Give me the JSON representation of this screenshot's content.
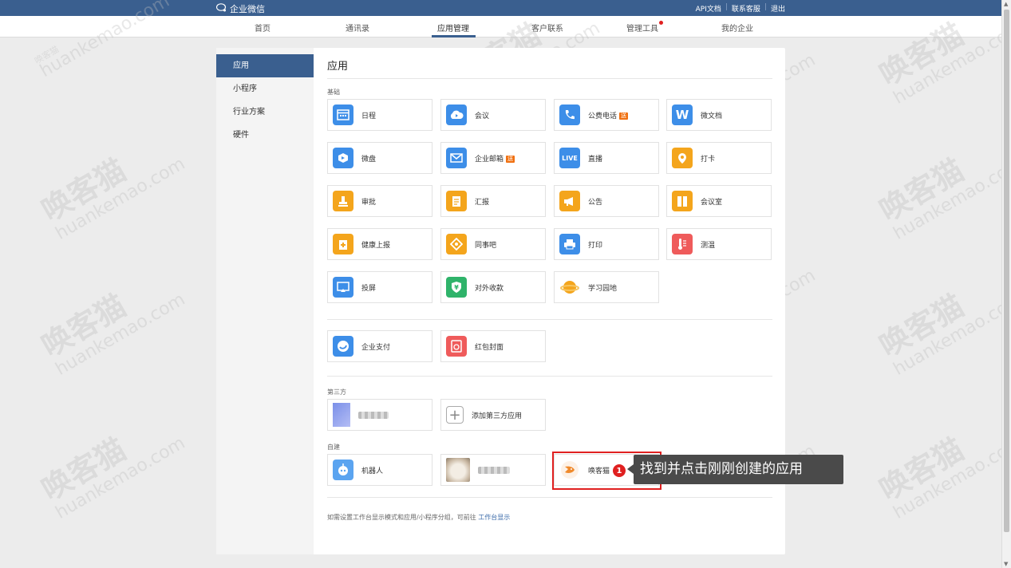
{
  "topbar": {
    "logo": "企业微信",
    "api": "API文档",
    "support": "联系客服",
    "logout": "退出"
  },
  "nav": {
    "tabs": [
      "首页",
      "通讯录",
      "应用管理",
      "客户联系",
      "管理工具",
      "我的企业"
    ]
  },
  "sidebar": {
    "items": [
      "应用",
      "小程序",
      "行业方案",
      "硬件"
    ]
  },
  "main": {
    "title": "应用",
    "basic_label": "基础",
    "basic_apps": [
      {
        "label": "日程",
        "icon": "calendar-icon"
      },
      {
        "label": "会议",
        "icon": "cloud-icon"
      },
      {
        "label": "公费电话",
        "icon": "phone-icon",
        "badge": "送"
      },
      {
        "label": "微文档",
        "icon": "doc-w-icon"
      },
      {
        "label": "微盘",
        "icon": "drive-icon"
      },
      {
        "label": "企业邮箱",
        "icon": "mail-icon",
        "badge": "送"
      },
      {
        "label": "直播",
        "icon": "live-icon"
      },
      {
        "label": "打卡",
        "icon": "location-icon"
      },
      {
        "label": "审批",
        "icon": "stamp-icon"
      },
      {
        "label": "汇报",
        "icon": "report-icon"
      },
      {
        "label": "公告",
        "icon": "megaphone-icon"
      },
      {
        "label": "会议室",
        "icon": "door-icon"
      },
      {
        "label": "健康上报",
        "icon": "health-icon"
      },
      {
        "label": "同事吧",
        "icon": "diamond-icon"
      },
      {
        "label": "打印",
        "icon": "printer-icon"
      },
      {
        "label": "测温",
        "icon": "thermometer-icon"
      },
      {
        "label": "投屏",
        "icon": "screen-icon"
      },
      {
        "label": "对外收款",
        "icon": "shield-yen-icon"
      },
      {
        "label": "学习园地",
        "icon": "planet-icon"
      }
    ],
    "extra_apps": [
      {
        "label": "企业支付",
        "icon": "pay-icon"
      },
      {
        "label": "红包封面",
        "icon": "red-packet-icon"
      }
    ],
    "third_party_label": "第三方",
    "add_third_party": "添加第三方应用",
    "custom_label": "自建",
    "custom_apps": [
      {
        "label": "机器人",
        "icon": "robot-icon"
      },
      {
        "label": "",
        "icon": "cat-photo-icon"
      },
      {
        "label": "唤客猫",
        "icon": "fox-icon"
      }
    ],
    "footer_text": "如需设置工作台显示模式和应用/小程序分组，可前往",
    "footer_link": "工作台显示"
  },
  "annotation": {
    "step": "1",
    "tip": "找到并点击刚刚创建的应用"
  },
  "watermark": {
    "cn": "唤客猫",
    "en": "huankemao.com"
  },
  "colors": {
    "header": "#3a5f8f",
    "highlight": "#e02020"
  }
}
